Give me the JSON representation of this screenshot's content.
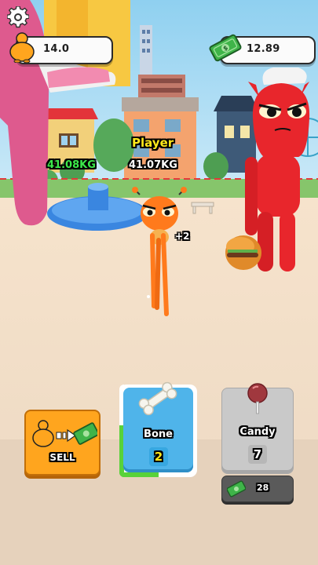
{
  "hud": {
    "weight_value": "14.0",
    "money_value": "12.89"
  },
  "world": {
    "player_name": "Player",
    "rival_weight": "41.08KG",
    "player_weight": "41.07KG",
    "gain_popup": "+2"
  },
  "actions": {
    "sell_label": "SELL",
    "cards": [
      {
        "name": "Bone",
        "count": "2",
        "progress": 0.5
      },
      {
        "name": "Candy",
        "count": "7",
        "price": "28"
      }
    ]
  },
  "colors": {
    "sell_orange": "#ffa51e",
    "bone_card_blue": "#4fb4ea",
    "candy_card_gray": "#c9c9c9",
    "money_green": "#3fb449",
    "progress_green": "#58d23a",
    "rival_red": "#e8262c",
    "player_orange": "#ff7a1c"
  }
}
